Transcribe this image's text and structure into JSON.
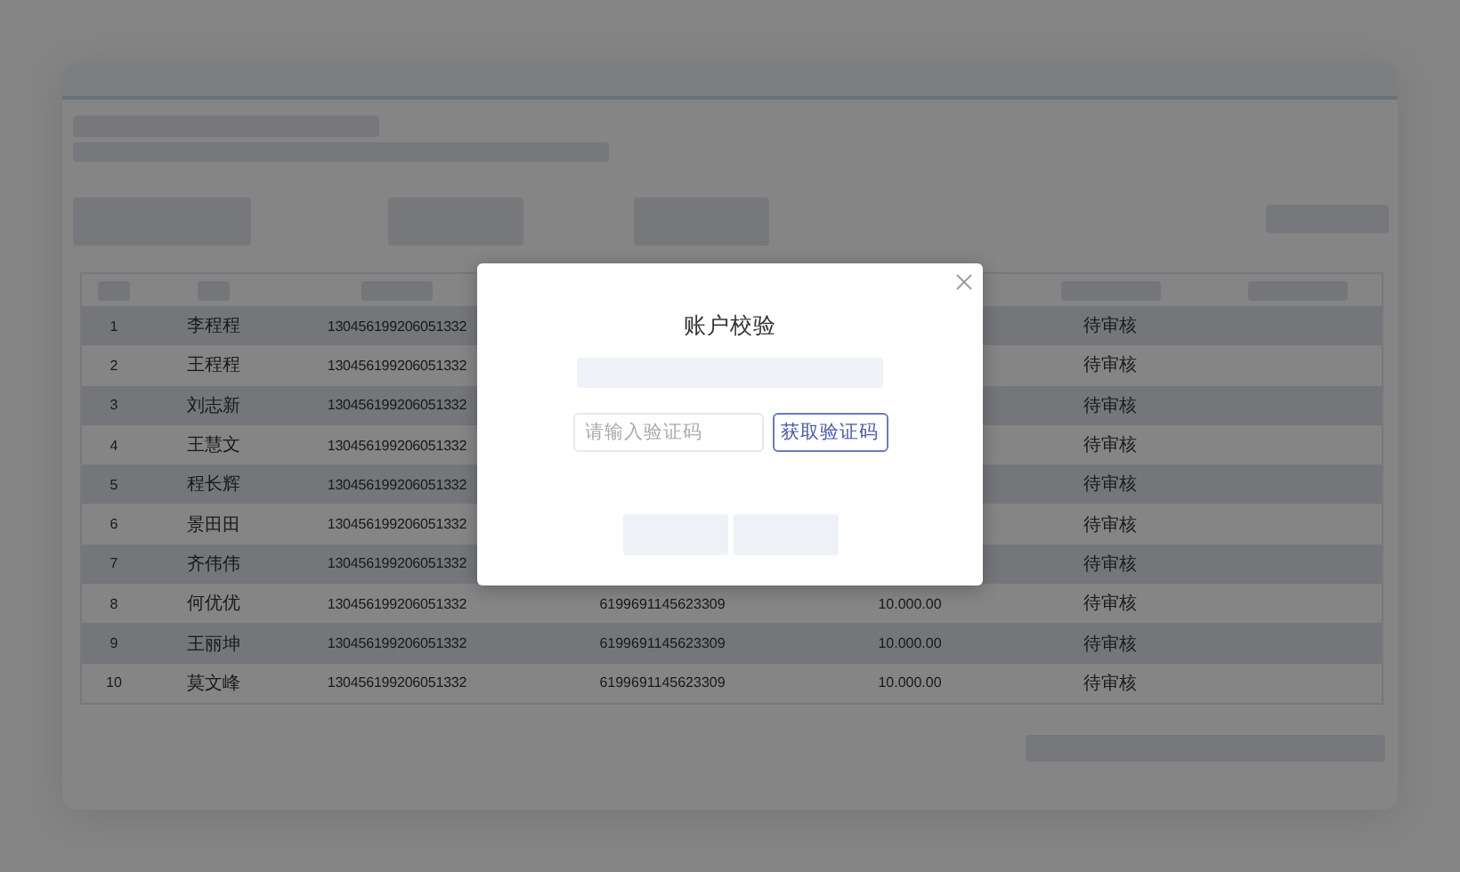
{
  "table": {
    "rows": [
      {
        "index": "1",
        "name": "李程程",
        "id_number": "130456199206051332",
        "status": "待审核"
      },
      {
        "index": "2",
        "name": "王程程",
        "id_number": "130456199206051332",
        "status": "待审核"
      },
      {
        "index": "3",
        "name": "刘志新",
        "id_number": "130456199206051332",
        "status": "待审核"
      },
      {
        "index": "4",
        "name": "王慧文",
        "id_number": "130456199206051332",
        "status": "待审核"
      },
      {
        "index": "5",
        "name": "程长辉",
        "id_number": "130456199206051332",
        "status": "待审核"
      },
      {
        "index": "6",
        "name": "景田田",
        "id_number": "130456199206051332",
        "status": "待审核"
      },
      {
        "index": "7",
        "name": "齐伟伟",
        "id_number": "130456199206051332",
        "status": "待审核"
      },
      {
        "index": "8",
        "name": "何优优",
        "id_number": "130456199206051332",
        "card_number": "6199691145623309",
        "amount": "10.000.00",
        "status": "待审核"
      },
      {
        "index": "9",
        "name": "王丽坤",
        "id_number": "130456199206051332",
        "card_number": "6199691145623309",
        "amount": "10.000.00",
        "status": "待审核"
      },
      {
        "index": "10",
        "name": "莫文峰",
        "id_number": "130456199206051332",
        "card_number": "6199691145623309",
        "amount": "10.000.00",
        "status": "待审核"
      }
    ]
  },
  "dialog": {
    "title": "账户校验",
    "code_field": {
      "placeholder": "请输入验证码"
    },
    "send_code_button": "获取验证码"
  }
}
